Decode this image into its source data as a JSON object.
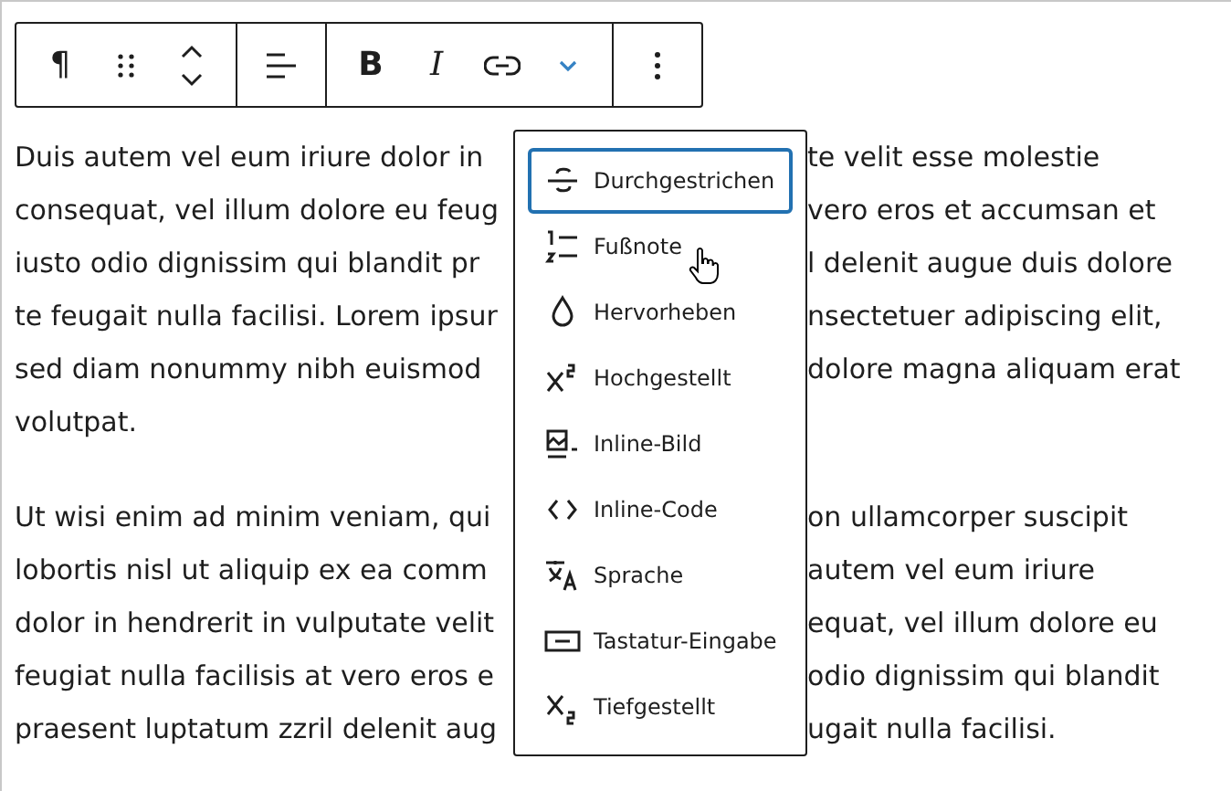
{
  "toolbar": {
    "paragraph": "¶",
    "bold": "B",
    "italic": "I"
  },
  "paragraphs": [
    {
      "lines": [
        {
          "left": "Duis autem vel eum iriure dolor in",
          "right": "te velit esse molestie"
        },
        {
          "left": "consequat, vel illum dolore eu feug",
          "right": "vero eros et accumsan et"
        },
        {
          "left": "iusto odio dignissim qui blandit pr",
          "right": "l delenit augue duis dolore"
        },
        {
          "left": "te feugait nulla facilisi. Lorem ipsur",
          "right": "nsectetuer adipiscing elit,"
        },
        {
          "left": "sed diam nonummy nibh euismod",
          "right": "dolore magna aliquam erat"
        },
        {
          "left": "volutpat."
        }
      ]
    },
    {
      "lines": [
        {
          "left": "Ut wisi enim ad minim veniam, qui",
          "right": "on ullamcorper suscipit"
        },
        {
          "left": "lobortis nisl ut aliquip ex ea comm",
          "right": "autem vel eum iriure"
        },
        {
          "left": "dolor in hendrerit in vulputate velit",
          "right": "equat, vel illum dolore eu"
        },
        {
          "left": "feugiat nulla facilisis at vero eros e",
          "right": "odio dignissim qui blandit"
        },
        {
          "left": "praesent luptatum zzril delenit aug",
          "right": "ugait nulla facilisi."
        }
      ]
    }
  ],
  "format_menu": {
    "items": [
      {
        "label": "Durchgestrichen",
        "selected": true
      },
      {
        "label": "Fußnote",
        "selected": false
      },
      {
        "label": "Hervorheben",
        "selected": false
      },
      {
        "label": "Hochgestellt",
        "selected": false
      },
      {
        "label": "Inline-Bild",
        "selected": false
      },
      {
        "label": "Inline-Code",
        "selected": false
      },
      {
        "label": "Sprache",
        "selected": false
      },
      {
        "label": "Tastatur-Eingabe",
        "selected": false
      },
      {
        "label": "Tiefgestellt",
        "selected": false
      }
    ]
  }
}
